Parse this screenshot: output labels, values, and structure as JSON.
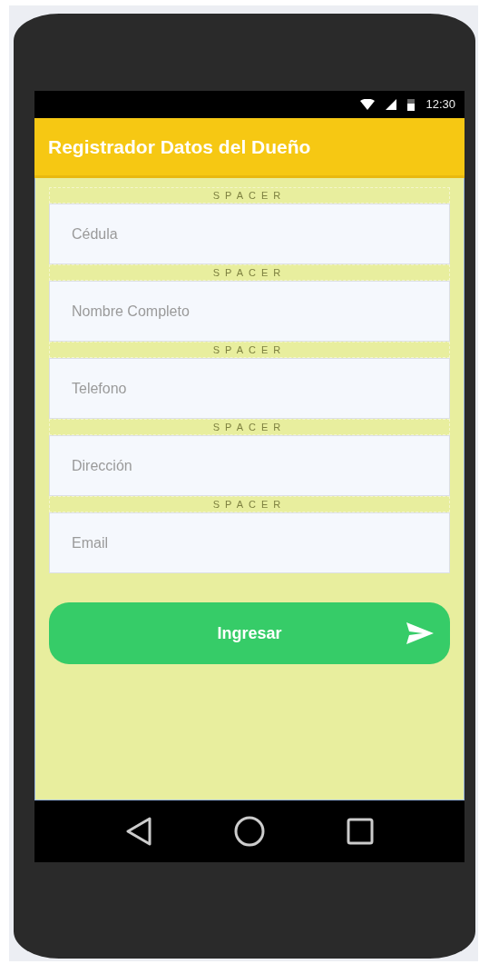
{
  "status_bar": {
    "time": "12:30"
  },
  "title": "Registrador Datos del Dueño",
  "form": [
    {
      "kind": "spacer",
      "text": "SPACER"
    },
    {
      "kind": "field",
      "placeholder": "Cédula"
    },
    {
      "kind": "spacer",
      "text": "SPACER"
    },
    {
      "kind": "field",
      "placeholder": "Nombre Completo"
    },
    {
      "kind": "spacer",
      "text": "SPACER"
    },
    {
      "kind": "field",
      "placeholder": "Telefono"
    },
    {
      "kind": "spacer",
      "text": "SPACER"
    },
    {
      "kind": "field",
      "placeholder": "Dirección"
    },
    {
      "kind": "spacer",
      "text": "SPACER"
    },
    {
      "kind": "field",
      "placeholder": "Email"
    }
  ],
  "submit_button": {
    "label": "Ingresar"
  }
}
